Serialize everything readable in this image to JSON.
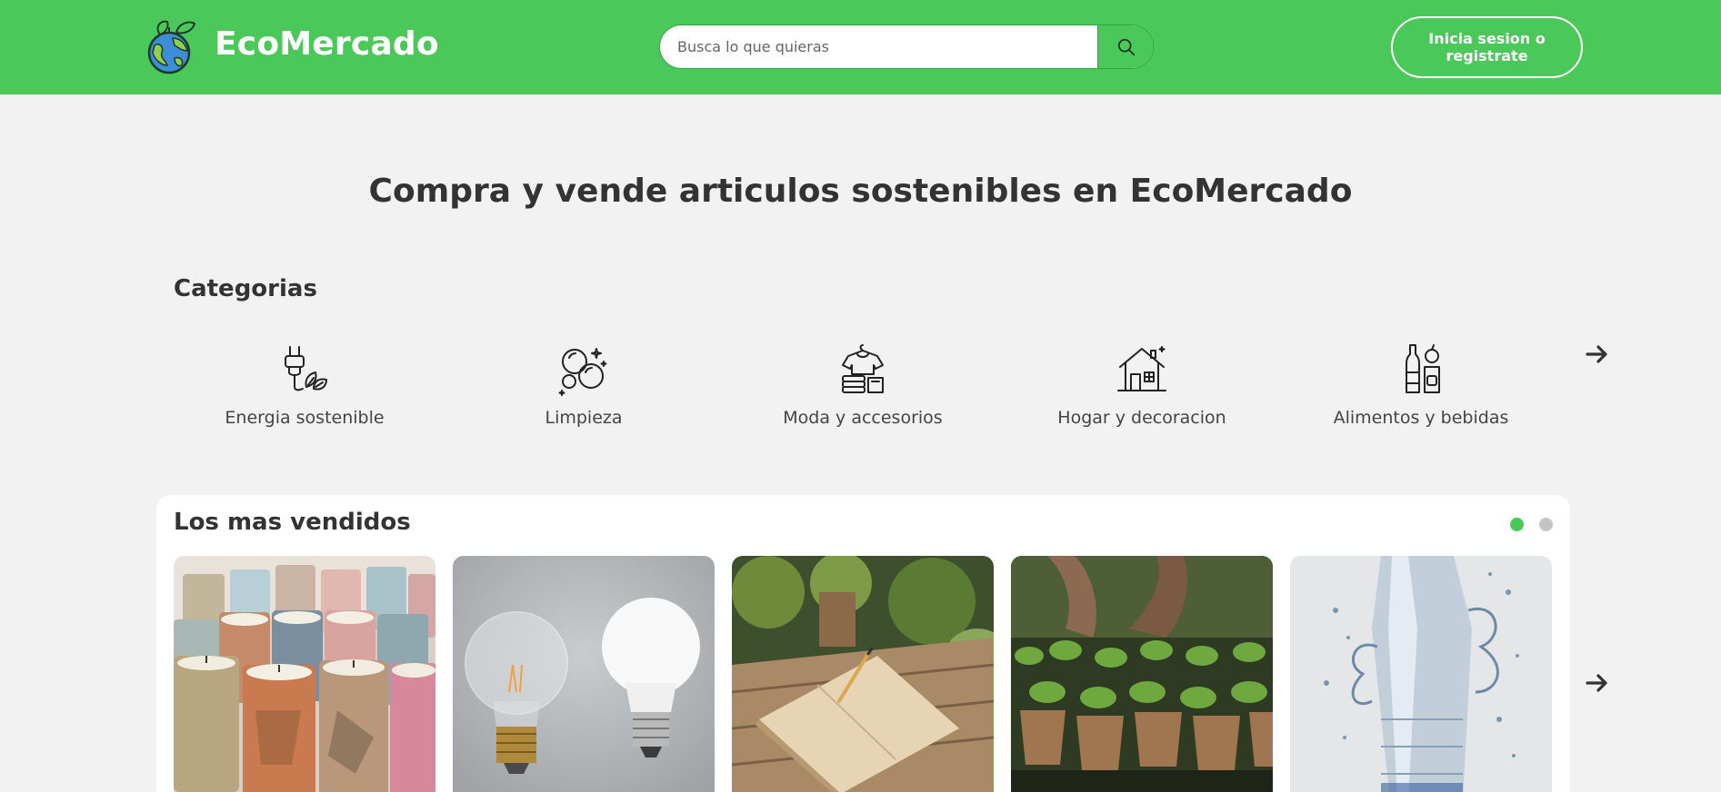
{
  "header": {
    "brand": "EcoMercado",
    "search_placeholder": "Busca lo que quieras",
    "login_label": "Inicia sesion o registrate"
  },
  "hero": {
    "title": "Compra y vende articulos sostenibles en EcoMercado"
  },
  "categories": {
    "heading": "Categorias",
    "items": [
      {
        "label": "Energia sostenible",
        "icon": "plug-leaf-icon"
      },
      {
        "label": "Limpieza",
        "icon": "bubbles-icon"
      },
      {
        "label": "Moda y accesorios",
        "icon": "tshirt-icon"
      },
      {
        "label": "Hogar y decoracion",
        "icon": "house-icon"
      },
      {
        "label": "Alimentos y bebidas",
        "icon": "bottles-icon"
      }
    ]
  },
  "best_sellers": {
    "title": "Los mas vendidos",
    "active_page": 1,
    "page_count": 2,
    "products": [
      {
        "image": "candles-photo"
      },
      {
        "image": "light-bulbs-photo"
      },
      {
        "image": "notebook-photo"
      },
      {
        "image": "seedlings-photo"
      },
      {
        "image": "water-bottle-photo"
      }
    ]
  },
  "colors": {
    "brand_green": "#4ac95a",
    "dot_active": "#4ac95a",
    "dot_inactive": "#c4c4c4"
  }
}
